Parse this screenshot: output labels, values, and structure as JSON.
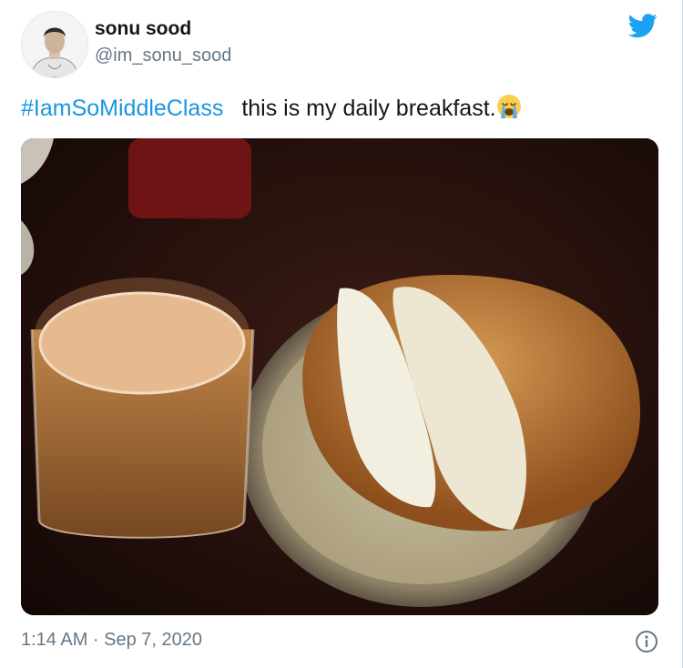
{
  "tweet": {
    "display_name": "sonu sood",
    "handle": "@im_sonu_sood",
    "hashtag": "#IamSoMiddleClass",
    "text": "this is my daily breakfast.",
    "timestamp": "1:14 AM · Sep 7, 2020",
    "emoji_icon": "loudly-crying-face-emoji"
  },
  "icons": {
    "brand": "twitter-bird-icon",
    "info": "info-icon"
  },
  "colors": {
    "link": "#1b95e0",
    "text": "#14171a",
    "muted": "#657786"
  }
}
